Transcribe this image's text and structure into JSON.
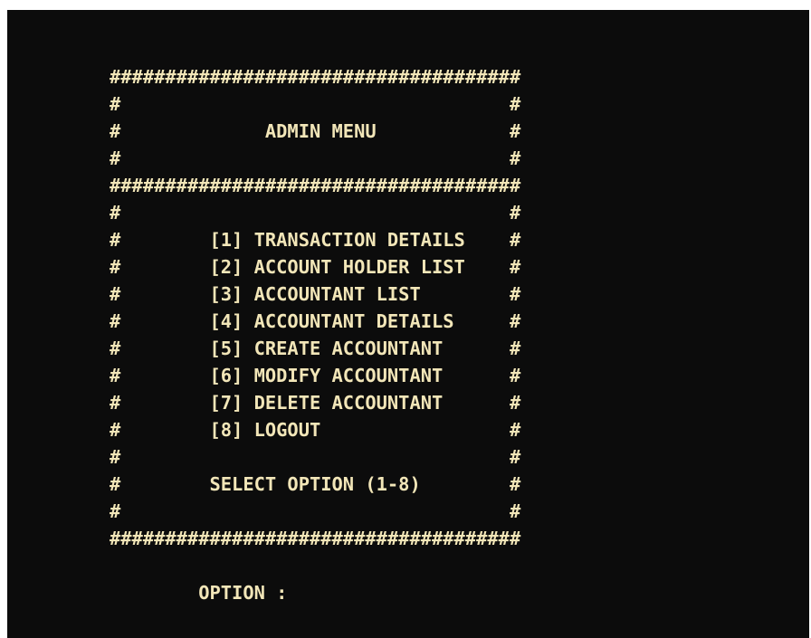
{
  "console": {
    "lines": [
      "#####################################",
      "#                                   #",
      "#             ADMIN MENU            #",
      "#                                   #",
      "#####################################",
      "#                                   #",
      "#        [1] TRANSACTION DETAILS    #",
      "#        [2] ACCOUNT HOLDER LIST    #",
      "#        [3] ACCOUNTANT LIST        #",
      "#        [4] ACCOUNTANT DETAILS     #",
      "#        [5] CREATE ACCOUNTANT      #",
      "#        [6] MODIFY ACCOUNTANT      #",
      "#        [7] DELETE ACCOUNTANT      #",
      "#        [8] LOGOUT                 #",
      "#                                   #",
      "#        SELECT OPTION (1-8)        #",
      "#                                   #",
      "#####################################",
      "",
      "        OPTION : "
    ]
  }
}
